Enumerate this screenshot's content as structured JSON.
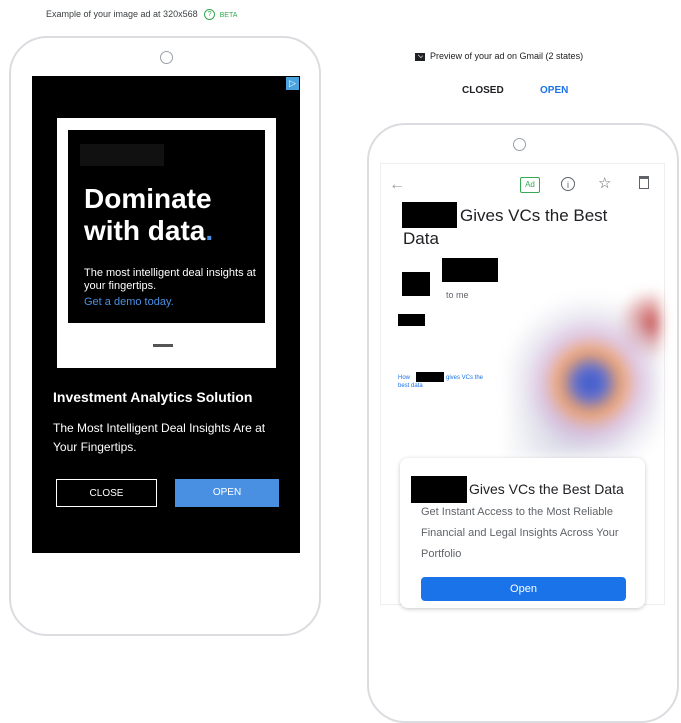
{
  "caption": {
    "text": "Example of your image ad at 320x568",
    "info_icon": "info-icon",
    "beta": "BETA",
    "accent": "#34a853"
  },
  "left_ad": {
    "adchoices_icon": "adchoices-icon",
    "creative": {
      "headline": "Dominate with data",
      "headline_dot": ".",
      "body": "The most intelligent deal insights at your fingertips.",
      "cta": "Get a demo today."
    },
    "title": "Investment Analytics Solution",
    "description": "The Most Intelligent Deal Insights Are at Your Fingertips.",
    "close_label": "CLOSE",
    "open_label": "OPEN",
    "accent": "#4a90e2"
  },
  "gmail": {
    "caption": "Preview of your ad on Gmail (2 states)",
    "mail_icon": "mail-icon",
    "states": {
      "closed": "CLOSED",
      "open": "OPEN"
    },
    "toolbar": {
      "back_icon": "back-arrow-icon",
      "ad_badge": "Ad",
      "info_icon": "info-icon",
      "star_icon": "star-icon",
      "trash_icon": "trash-icon"
    },
    "subject_part1": "Gives VCs the Best",
    "subject_part2": "Data",
    "to_me": "to me",
    "body_link_left": "How",
    "body_link_right": "gives VCs the",
    "body_link_line2": "best data",
    "card": {
      "title": "Gives VCs the Best Data",
      "description": "Get Instant Access to the Most Reliable Financial and Legal Insights Across Your Portfolio",
      "button": "Open"
    },
    "accent": "#1a73e8"
  }
}
